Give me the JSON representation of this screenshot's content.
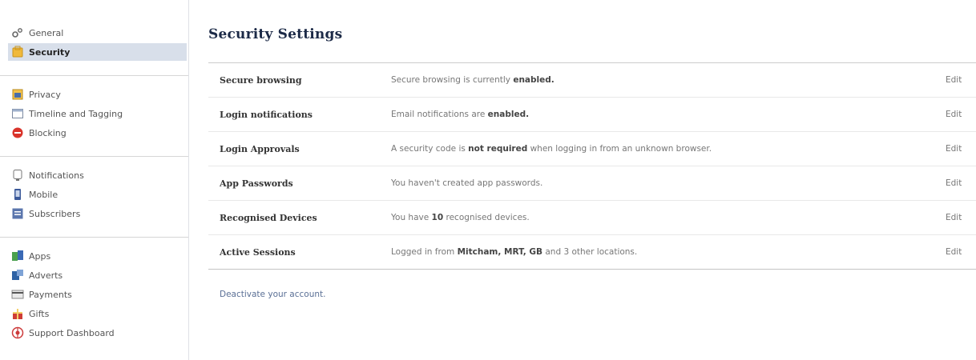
{
  "sidebar": {
    "groups": [
      [
        {
          "label": "General",
          "icon": "gear-icon"
        },
        {
          "label": "Security",
          "icon": "shield-icon",
          "active": true
        }
      ],
      [
        {
          "label": "Privacy",
          "icon": "lock-icon"
        },
        {
          "label": "Timeline and Tagging",
          "icon": "timeline-icon"
        },
        {
          "label": "Blocking",
          "icon": "block-icon"
        }
      ],
      [
        {
          "label": "Notifications",
          "icon": "globe-icon"
        },
        {
          "label": "Mobile",
          "icon": "mobile-icon"
        },
        {
          "label": "Subscribers",
          "icon": "rss-icon"
        }
      ],
      [
        {
          "label": "Apps",
          "icon": "apps-icon"
        },
        {
          "label": "Adverts",
          "icon": "adverts-icon"
        },
        {
          "label": "Payments",
          "icon": "payments-icon"
        },
        {
          "label": "Gifts",
          "icon": "gift-icon"
        },
        {
          "label": "Support Dashboard",
          "icon": "support-icon"
        }
      ]
    ]
  },
  "main": {
    "title": "Security Settings",
    "rows": [
      {
        "label": "Secure browsing",
        "desc": [
          [
            "Secure browsing is currently ",
            false
          ],
          [
            "enabled.",
            true
          ]
        ],
        "edit": "Edit"
      },
      {
        "label": "Login notifications",
        "desc": [
          [
            "Email notifications are ",
            false
          ],
          [
            "enabled.",
            true
          ]
        ],
        "edit": "Edit"
      },
      {
        "label": "Login Approvals",
        "desc": [
          [
            "A security code is ",
            false
          ],
          [
            "not required",
            true
          ],
          [
            " when logging in from an unknown browser.",
            false
          ]
        ],
        "edit": "Edit"
      },
      {
        "label": "App Passwords",
        "desc": [
          [
            "You haven't created app passwords.",
            false
          ]
        ],
        "edit": "Edit"
      },
      {
        "label": "Recognised Devices",
        "desc": [
          [
            "You have ",
            false
          ],
          [
            "10",
            true
          ],
          [
            " recognised devices.",
            false
          ]
        ],
        "edit": "Edit"
      },
      {
        "label": "Active Sessions",
        "desc": [
          [
            "Logged in from ",
            false
          ],
          [
            "Mitcham, MRT, GB",
            true
          ],
          [
            " and 3 other locations.",
            false
          ]
        ],
        "edit": "Edit"
      }
    ],
    "deactivate": "Deactivate your account."
  }
}
